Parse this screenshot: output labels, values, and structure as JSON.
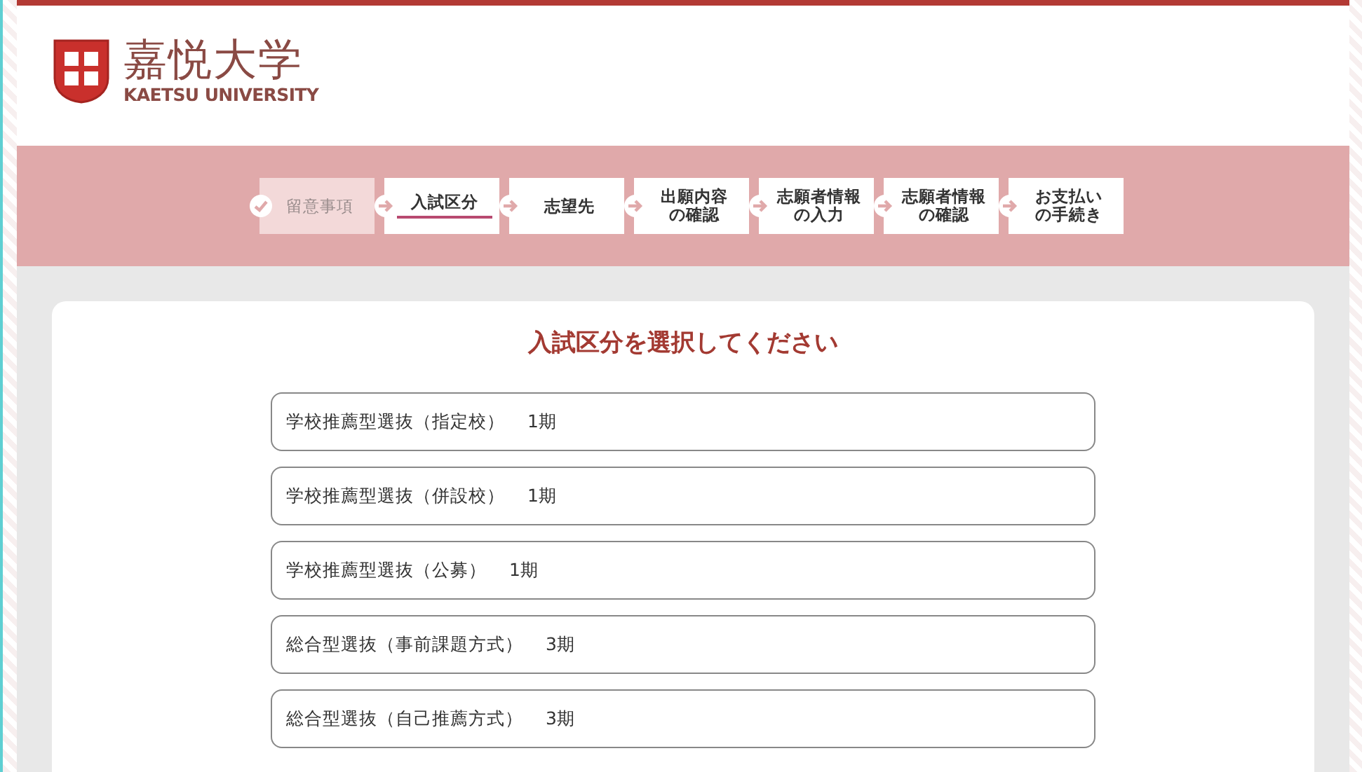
{
  "header": {
    "logo_title": "嘉悦大学",
    "logo_subtitle": "KAETSU UNIVERSITY"
  },
  "steps": [
    {
      "lines": [
        "留意事項"
      ],
      "completed": true,
      "selected": false
    },
    {
      "lines": [
        "入試区分"
      ],
      "completed": false,
      "selected": true
    },
    {
      "lines": [
        "志望先"
      ],
      "completed": false,
      "selected": false
    },
    {
      "lines": [
        "出願内容",
        "の確認"
      ],
      "completed": false,
      "selected": false
    },
    {
      "lines": [
        "志願者情報",
        "の入力"
      ],
      "completed": false,
      "selected": false
    },
    {
      "lines": [
        "志願者情報",
        "の確認"
      ],
      "completed": false,
      "selected": false
    },
    {
      "lines": [
        "お支払い",
        "の手続き"
      ],
      "completed": false,
      "selected": false
    }
  ],
  "heading": "入試区分を選択してください",
  "options": [
    {
      "name": "学校推薦型選抜（指定校）",
      "term": "1期"
    },
    {
      "name": "学校推薦型選抜（併設校）",
      "term": "1期"
    },
    {
      "name": "学校推薦型選抜（公募）",
      "term": "1期"
    },
    {
      "name": "総合型選抜（事前課題方式）",
      "term": "3期"
    },
    {
      "name": "総合型選抜（自己推薦方式）",
      "term": "3期"
    }
  ]
}
